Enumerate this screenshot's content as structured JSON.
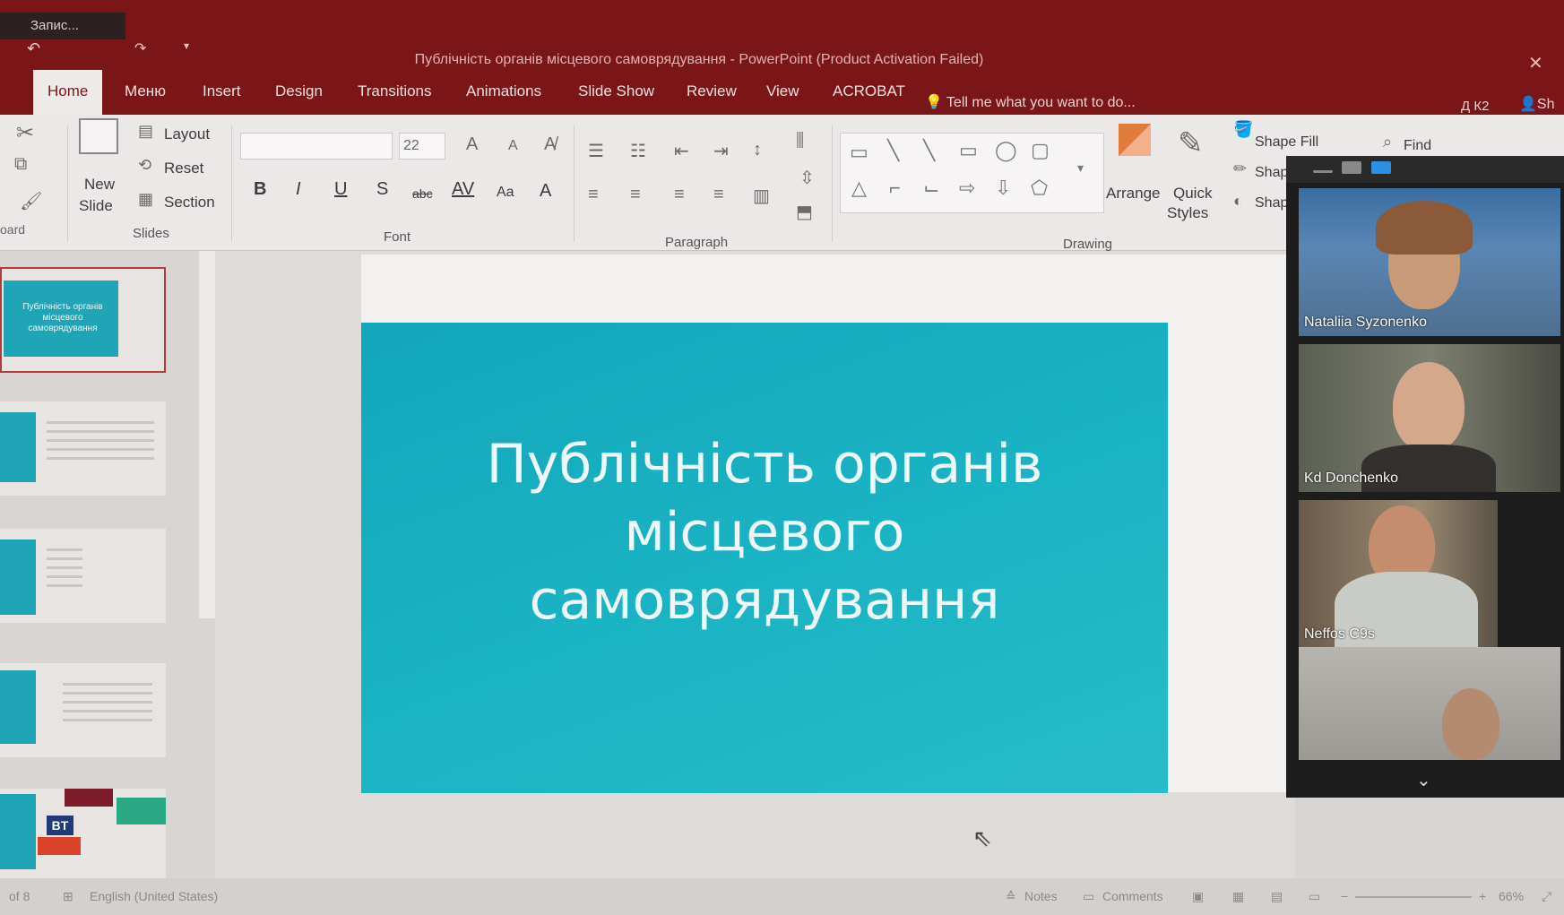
{
  "titlebar": {
    "recording_label": "Запис...",
    "window_title": "Публічність органів місцевого самоврядування - PowerPoint (Product Activation Failed)",
    "close_symbol": "✕"
  },
  "tabs": [
    {
      "label": "Home"
    },
    {
      "label": "Меню"
    },
    {
      "label": "Insert"
    },
    {
      "label": "Design"
    },
    {
      "label": "Transitions"
    },
    {
      "label": "Animations"
    },
    {
      "label": "Slide Show"
    },
    {
      "label": "Review"
    },
    {
      "label": "View"
    },
    {
      "label": "ACROBAT"
    }
  ],
  "tell_me": "Tell me what you want to do...",
  "user": {
    "name": "Д К2",
    "share": "Sh"
  },
  "ribbon": {
    "clipboard_label": "oard",
    "new_slide": {
      "line1": "New",
      "line2": "Slide"
    },
    "layout": "Layout",
    "reset": "Reset",
    "section": "Section",
    "slides_label": "Slides",
    "font_size": "22",
    "font_label": "Font",
    "paragraph_label": "Paragraph",
    "arrange": "Arrange",
    "quick_styles": {
      "line1": "Quick",
      "line2": "Styles"
    },
    "shape_fill": "Shape Fill",
    "shape_outline": "Shape",
    "shape_effects": "Shape",
    "drawing_label": "Drawing",
    "find": "Find",
    "font_buttons": [
      "B",
      "I",
      "U",
      "S",
      "abc",
      "AV",
      "Aa",
      "A"
    ]
  },
  "thumbnails": {
    "slide1_text": "Публічність органів місцевого самоврядування",
    "bt_logo": "BT"
  },
  "slide": {
    "title_line1": "Публічність органів",
    "title_line2": "місцевого",
    "title_line3": "самоврядування",
    "background_color": "#1ab3c3"
  },
  "status": {
    "slide_count": "of 8",
    "language": "English (United States)",
    "notes": "Notes",
    "comments": "Comments",
    "zoom": "66%"
  },
  "video": {
    "participants": [
      {
        "name": "Nataliia Syzonenko"
      },
      {
        "name": "Kd Donchenko"
      },
      {
        "name": "Neffos C9s"
      },
      {
        "name": ""
      }
    ],
    "more_icon": "chevron-down"
  }
}
